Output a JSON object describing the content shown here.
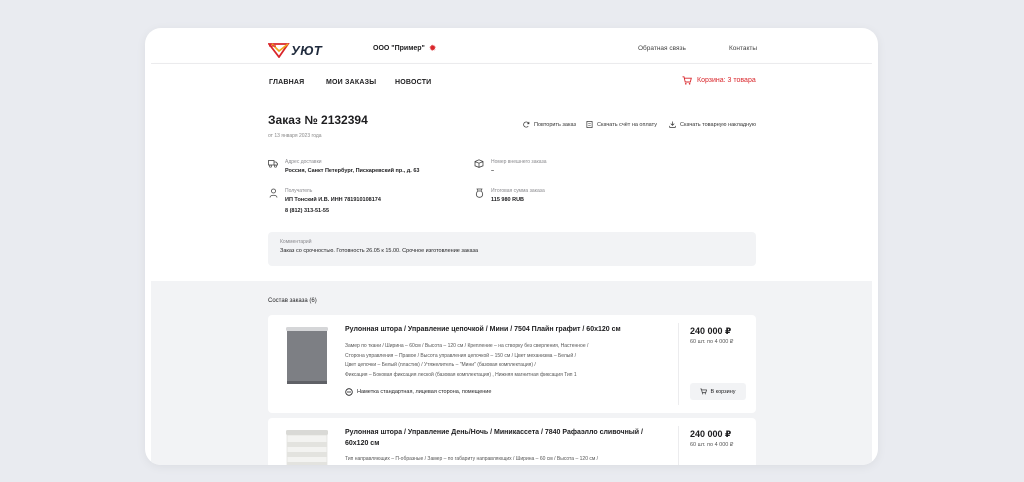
{
  "header": {
    "logo_text": "УЮТ",
    "company": "ООО \"Пример\"",
    "links": [
      "Обратная связь",
      "Контакты"
    ]
  },
  "nav": {
    "items": [
      "ГЛАВНАЯ",
      "МОИ ЗАКАЗЫ",
      "НОВОСТИ"
    ],
    "cart_label": "Корзина: 3 товара"
  },
  "order": {
    "title": "Заказ № 2132394",
    "date": "от 13 января 2023 года",
    "actions": [
      "Повторить заказ",
      "Скачать счёт на оплату",
      "Скачать товарную накладную"
    ],
    "delivery_label": "Адрес доставки",
    "delivery_value": "Россия, Санкт Петербург, Пискаревский пр., д. 63",
    "external_label": "Номер внешнего заказа",
    "external_value": "–",
    "recipient_label": "Получатель",
    "recipient_value": "ИП Тонский И.В.  ИНН 781910108174",
    "recipient_phone": "8 (812) 313-51-55",
    "total_label": "Итоговая сумма заказа",
    "total_value": "115 980 RUB",
    "comment_label": "Комментарий",
    "comment_text": "Заказ со срочностью. Готовность 26.05 к 15.00. Срочное изготовление заказа"
  },
  "composition": {
    "title": "Состав заказа (6)",
    "products": [
      {
        "name": "Рулонная штора / Управление цепочкой / Мини / 7504 Плайн графит / 60x120 см",
        "specs": [
          "Замер по ткани  /  Ширина – 60см  /  Высота – 120 см  /  Крепление – на створку без сверления, Настенное  /",
          "Сторона управления – Правое  /  Высота управления цепочкой – 150 см  /  Цвет механизма – Белый  /",
          "Цвет цепочки – Белый (пластик)  /  Утяжелитель – \"Мини\" (базовая комплектация)  /",
          "Фиксация – Боковая фиксация леской (базовая комплектация)  ,  Нижняя магнитная  фиксация Тип 1"
        ],
        "note": "Наметка стандартная, лицевая сторона, помещение",
        "price": "240 000 ₽",
        "unit_price": "60 шт. по 4 000 ₽",
        "cart_button": "В корзину",
        "color": "#7d7f84"
      },
      {
        "name": "Рулонная штора / Управление День/Ночь / Миникассета / 7840 Рафаэлло сливочный / 60x120 см",
        "specs": [
          "Тип направляющих – П-образные  /  Замер – по габариту направляющих  /  Ширина – 60 см  /  Высота – 120 см  /"
        ],
        "price": "240 000 ₽",
        "unit_price": "60 шт. по 4 000 ₽",
        "color": "#eeeeec"
      }
    ]
  }
}
